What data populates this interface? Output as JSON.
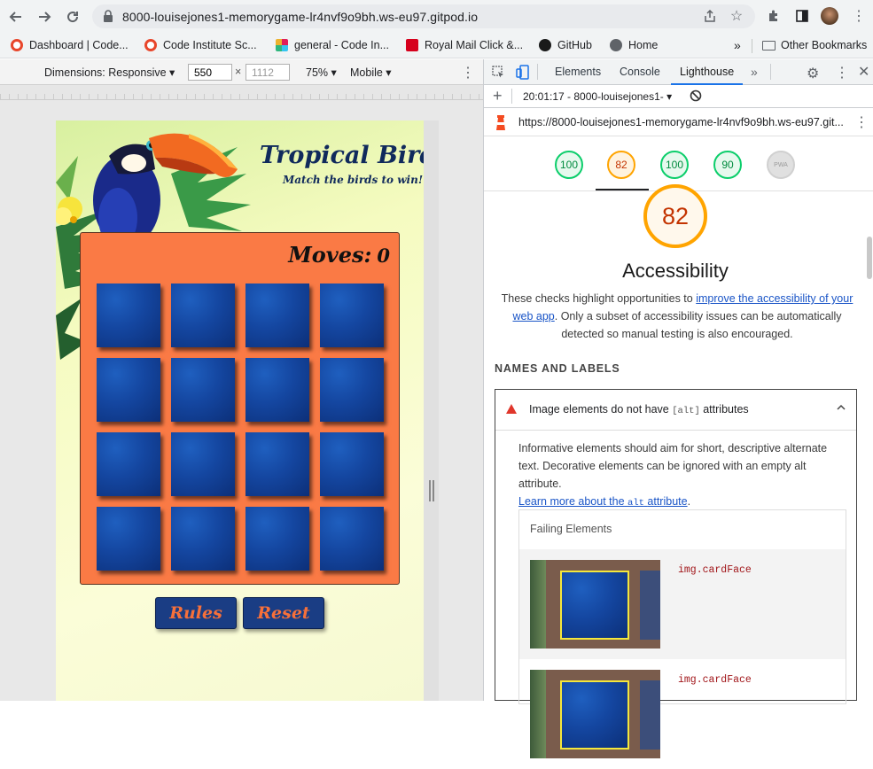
{
  "browser": {
    "url": "8000-louisejones1-memorygame-lr4nvf9o9bh.ws-eu97.gitpod.io",
    "bookmarks": [
      {
        "label": "Dashboard | Code...",
        "icon": "code-institute-icon",
        "color": "#e8462b"
      },
      {
        "label": "Code Institute Sc...",
        "icon": "code-institute-icon",
        "color": "#e8462b"
      },
      {
        "label": "general - Code In...",
        "icon": "slack-icon",
        "color": "#4a154b"
      },
      {
        "label": "Royal Mail Click &...",
        "icon": "royal-mail-icon",
        "color": "#d6001c"
      },
      {
        "label": "GitHub",
        "icon": "github-icon",
        "color": "#1a1a1a"
      },
      {
        "label": "Home",
        "icon": "globe-icon",
        "color": "#5f6368"
      }
    ],
    "overflow": "»",
    "other_bookmarks": "Other Bookmarks"
  },
  "device_toolbar": {
    "dimensions": "Dimensions: Responsive ▾",
    "width": "550",
    "height": "1112",
    "times": "×",
    "zoom": "75% ▾",
    "device": "Mobile ▾"
  },
  "game": {
    "title": "Tropical Birds",
    "subtitle": "Match the birds to win!",
    "moves_label": "Moves:",
    "moves_value": "0",
    "rules_label": "Rules",
    "reset_label": "Reset",
    "accent_color": "#fa7a45",
    "card_color": "#1446a0"
  },
  "devtools": {
    "tabs": [
      "Elements",
      "Console",
      "Lighthouse"
    ],
    "active_tab": "Lighthouse",
    "more": "»",
    "report_time": "20:01:17 - 8000-louisejones1- ▾",
    "report_url": "https://8000-louisejones1-memorygame-lr4nvf9o9bh.ws-eu97.git...",
    "scores": [
      {
        "value": "100",
        "status": "pass"
      },
      {
        "value": "82",
        "status": "average"
      },
      {
        "value": "100",
        "status": "pass"
      },
      {
        "value": "90",
        "status": "pass"
      },
      {
        "value": "PWA",
        "status": "na"
      }
    ],
    "accessibility_score": "82",
    "accessibility_title": "Accessibility",
    "desc_part1": "These checks highlight opportunities to",
    "desc_link": "improve the accessibility of your web app",
    "desc_part2": ". Only a subset of accessibility issues can be automatically detected so manual testing is also encouraged.",
    "section_header": "NAMES AND LABELS",
    "audit_title_pre": "Image elements do not have",
    "audit_title_code": "[alt]",
    "audit_title_post": "attributes",
    "audit_desc": "Informative elements should aim for short, descriptive alternate text. Decorative elements can be ignored with an empty alt attribute.",
    "audit_learn_pre": "Learn more about the",
    "audit_learn_code": "alt",
    "audit_learn_post": "attribute",
    "audit_learn_end": ".",
    "failing_title": "Failing Elements",
    "failing_items": [
      "img.cardFace",
      "img.cardFace"
    ]
  }
}
